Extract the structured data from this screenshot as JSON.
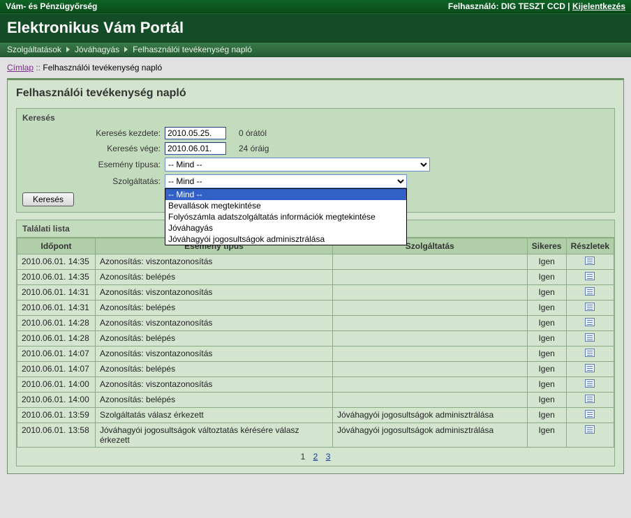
{
  "topbar": {
    "org": "Vám- és Pénzügyőrség",
    "user_prefix": "Felhasználó: ",
    "user": "DIG TESZT CCD",
    "sep": " | ",
    "logout": "Kijelentkezés"
  },
  "title": "Elektronikus Vám Portál",
  "breadcrumb_dark": {
    "items": [
      "Szolgáltatások",
      "Jóváhagyás",
      "Felhasználói tevékenység napló"
    ]
  },
  "path": {
    "home": "Címlap",
    "sep": " :: ",
    "current": "Felhasználói tevékenység napló"
  },
  "panel": {
    "heading": "Felhasználói tevékenység napló",
    "search": {
      "section_title": "Keresés",
      "start_label": "Keresés kezdete:",
      "start_value": "2010.05.25.",
      "start_suffix": "0 órától",
      "end_label": "Keresés vége:",
      "end_value": "2010.06.01.",
      "end_suffix": "24 óráig",
      "event_type_label": "Esemény típusa:",
      "event_type_value": "-- Mind --",
      "service_label": "Szolgáltatás:",
      "service_value": "-- Mind --",
      "service_options": [
        "-- Mind --",
        "Bevallások megtekintése",
        "Folyószámla adatszolgáltatás információk megtekintése",
        "Jóváhagyás",
        "Jóváhagyói jogosultságok adminisztrálása"
      ],
      "submit": "Keresés"
    },
    "results": {
      "section_title": "Találati lista",
      "columns": [
        "Időpont",
        "Esemény típus",
        "Szolgáltatás",
        "Sikeres",
        "Részletek"
      ],
      "rows": [
        {
          "time": "2010.06.01. 14:35",
          "event": "Azonosítás: viszontazonosítás",
          "service": "",
          "success": "Igen"
        },
        {
          "time": "2010.06.01. 14:35",
          "event": "Azonosítás: belépés",
          "service": "",
          "success": "Igen"
        },
        {
          "time": "2010.06.01. 14:31",
          "event": "Azonosítás: viszontazonosítás",
          "service": "",
          "success": "Igen"
        },
        {
          "time": "2010.06.01. 14:31",
          "event": "Azonosítás: belépés",
          "service": "",
          "success": "Igen"
        },
        {
          "time": "2010.06.01. 14:28",
          "event": "Azonosítás: viszontazonosítás",
          "service": "",
          "success": "Igen"
        },
        {
          "time": "2010.06.01. 14:28",
          "event": "Azonosítás: belépés",
          "service": "",
          "success": "Igen"
        },
        {
          "time": "2010.06.01. 14:07",
          "event": "Azonosítás: viszontazonosítás",
          "service": "",
          "success": "Igen"
        },
        {
          "time": "2010.06.01. 14:07",
          "event": "Azonosítás: belépés",
          "service": "",
          "success": "Igen"
        },
        {
          "time": "2010.06.01. 14:00",
          "event": "Azonosítás: viszontazonosítás",
          "service": "",
          "success": "Igen"
        },
        {
          "time": "2010.06.01. 14:00",
          "event": "Azonosítás: belépés",
          "service": "",
          "success": "Igen"
        },
        {
          "time": "2010.06.01. 13:59",
          "event": "Szolgáltatás válasz érkezett",
          "service": "Jóváhagyói jogosultságok adminisztrálása",
          "success": "Igen"
        },
        {
          "time": "2010.06.01. 13:58",
          "event": "Jóváhagyói jogosultságok változtatás kérésére válasz érkezett",
          "service": "Jóváhagyói jogosultságok adminisztrálása",
          "success": "Igen"
        }
      ],
      "pager": {
        "current": "1",
        "p2": "2",
        "p3": "3"
      }
    }
  }
}
